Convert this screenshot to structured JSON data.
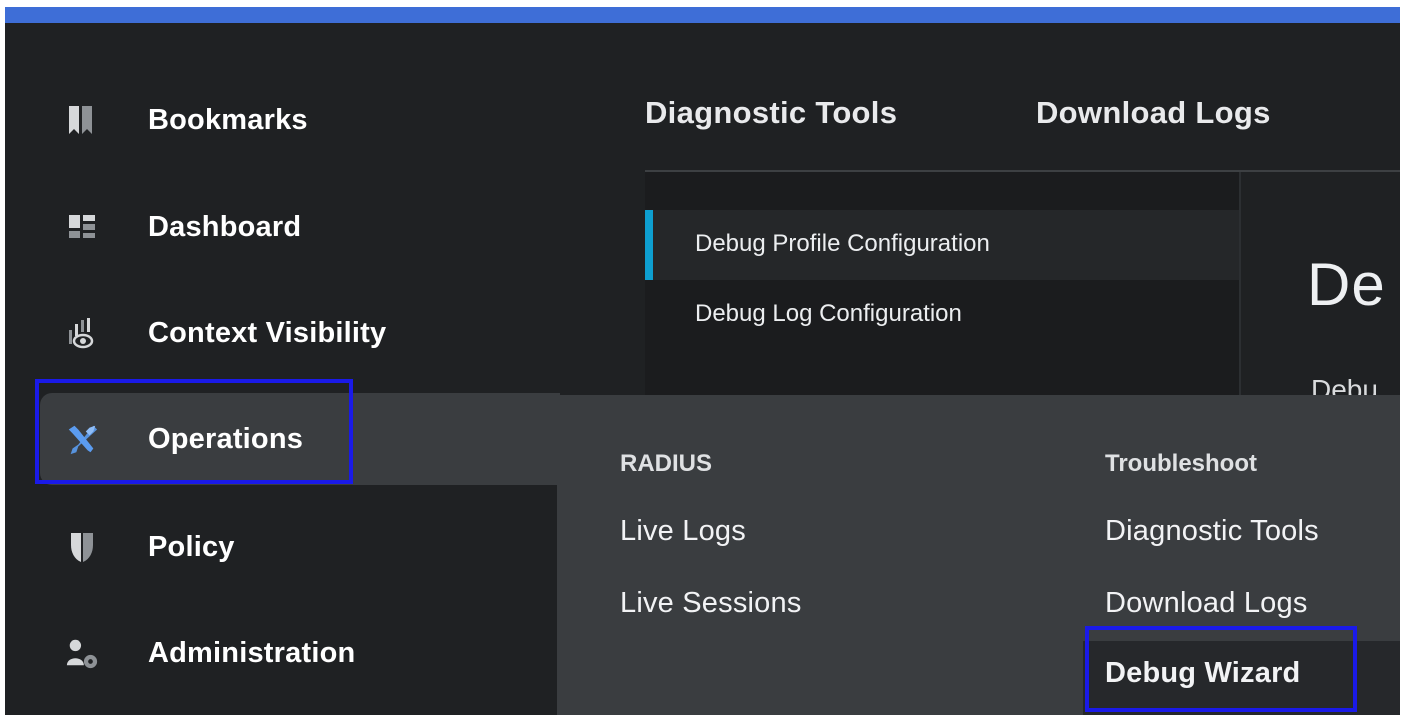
{
  "sidebar": {
    "items": [
      {
        "label": "Bookmarks",
        "icon": "bookmark-icon"
      },
      {
        "label": "Dashboard",
        "icon": "dashboard-icon"
      },
      {
        "label": "Context Visibility",
        "icon": "context-visibility-icon"
      },
      {
        "label": "Operations",
        "icon": "wrench-screwdriver-icon"
      },
      {
        "label": "Policy",
        "icon": "shield-icon"
      },
      {
        "label": "Administration",
        "icon": "user-gear-icon"
      }
    ]
  },
  "tabs": [
    "Diagnostic Tools",
    "Download Logs"
  ],
  "submenu": {
    "items": [
      "Debug Profile Configuration",
      "Debug Log Configuration"
    ]
  },
  "content": {
    "title_partial": "De",
    "subtitle_partial": "Debu"
  },
  "dropdown": {
    "radius": {
      "heading": "RADIUS",
      "items": [
        "Live Logs",
        "Live Sessions"
      ]
    },
    "troubleshoot": {
      "heading": "Troubleshoot",
      "items": [
        "Diagnostic Tools",
        "Download Logs",
        "Debug Wizard"
      ]
    }
  },
  "colors": {
    "accent": "#0e9fd0",
    "highlight_box": "#1a1ae8",
    "icon_active": "#5b9cf0"
  }
}
